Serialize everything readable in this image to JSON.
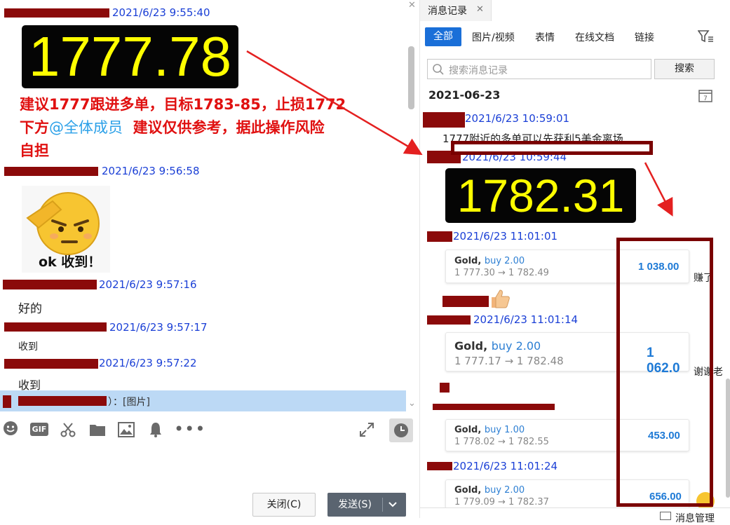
{
  "left": {
    "messages": [
      {
        "time": "2021/6/23 9:55:40"
      },
      {
        "time": "2021/6/23 9:56:58"
      },
      {
        "time": "2021/6/23 9:57:16",
        "text": "好的"
      },
      {
        "time": "2021/6/23 9:57:17",
        "text": "收到"
      },
      {
        "time": "2021/6/23 9:57:22",
        "text": "收到"
      }
    ],
    "price1": "1777.78",
    "advice_line1": "建议1777跟进多单，目标1783-85，止损1772",
    "advice_line2_a": "下方",
    "advice_mention": "@全体成员",
    "advice_line2_b": "  建议仅供参考，据此操作风险",
    "advice_line3": "自担",
    "sticker_caption": "ok 收到！",
    "reply_preview": "）：[图片]",
    "gif_label": "GIF",
    "close_label": "关闭(C)",
    "send_label": "发送(S)"
  },
  "right": {
    "panel_title": "消息记录",
    "tabs": [
      "全部",
      "图片/视频",
      "表情",
      "在线文档",
      "链接"
    ],
    "search_placeholder": "搜索消息记录",
    "search_button": "搜索",
    "date": "2021-06-23",
    "msg1_time": "2021/6/23 10:59:01",
    "msg1_text": "1777附近的多单可以先获利5美金离场",
    "msg2_time": "2021/6/23 10:59:44",
    "price2": "1782.31",
    "msg3_time": "2021/6/23 11:01:01",
    "msg4_time": "2021/6/23 11:01:14",
    "msg5_time": "2021/6/23 11:01:24",
    "side_text1": "赚了",
    "side_text2": "谢谢老",
    "bottom_label": "消息管理",
    "trades": [
      {
        "symbol": "Gold,",
        "side": "buy 2.00",
        "range": "1 777.30 → 1 782.49",
        "profit": "1 038.00"
      },
      {
        "symbol": "Gold,",
        "side": "buy 2.00",
        "range": "1 777.17 → 1 782.48",
        "profit": "1 062.0"
      },
      {
        "symbol": "Gold,",
        "side": "buy 1.00",
        "range": "1 778.02 → 1 782.55",
        "profit": "453.00"
      },
      {
        "symbol": "Gold,",
        "side": "buy 2.00",
        "range": "1 779.09 → 1 782.37",
        "profit": "656.00"
      }
    ]
  },
  "colors": {
    "accent": "#1a6fd8",
    "annotation": "#e42020",
    "redact": "#8b0a0a",
    "timestamp": "#1a3fd6"
  }
}
